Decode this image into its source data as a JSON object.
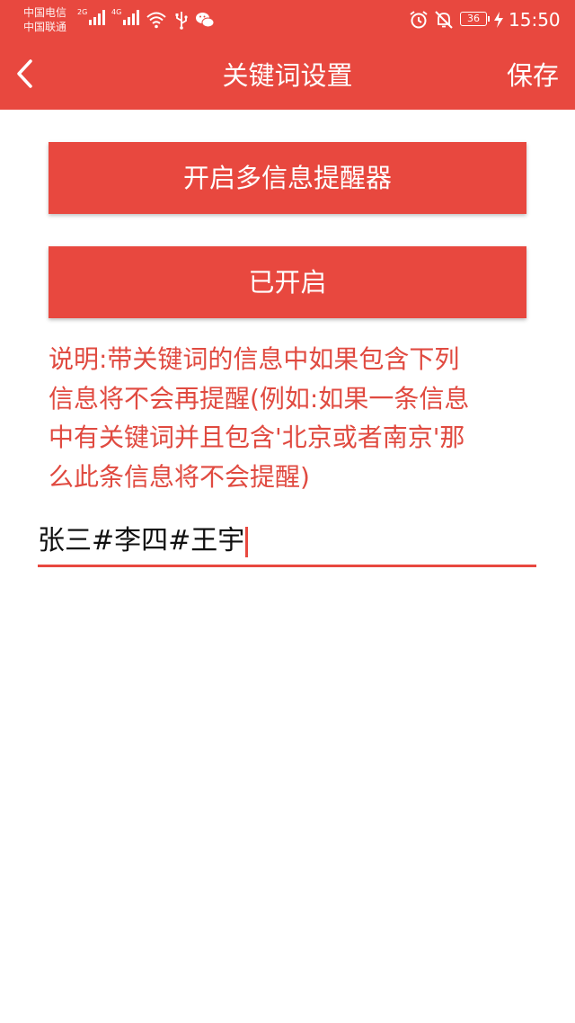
{
  "status_bar": {
    "carrier_1": "中国电信",
    "carrier_2": "中国联通",
    "signal_1_tag": "2G",
    "signal_2_tag": "4G",
    "battery_level": "36",
    "time": "15:50",
    "icons": [
      "signal-icon",
      "signal-icon",
      "wifi-icon",
      "usb-icon",
      "wechat-icon",
      "alarm-icon",
      "mute-icon",
      "battery-icon",
      "charging-icon"
    ]
  },
  "header": {
    "title": "关键词设置",
    "back_icon": "chevron-left-icon",
    "save_label": "保存"
  },
  "main": {
    "button_open_multi": "开启多信息提醒器",
    "button_enabled": "已开启",
    "description_lines": [
      "说明:带关键词的信息中如果包含下列",
      "信息将不会再提醒(例如:如果一条信息",
      "中有关键词并且包含'北京或者南京'那",
      "么此条信息将不会提醒)"
    ],
    "keyword_input_value": "张三#李四#王宇"
  },
  "colors": {
    "accent": "#e8483f",
    "description_text": "#e04a40",
    "background": "#ffffff"
  }
}
